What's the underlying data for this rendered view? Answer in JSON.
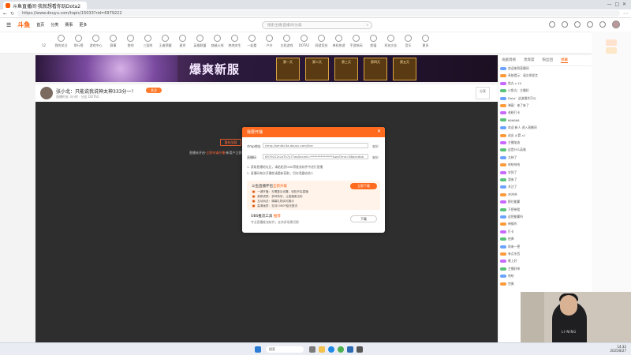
{
  "browser": {
    "tab_title": "斗鱼直播间·我就想看你玩Dota2",
    "url": "https://www.douyu.com/topic/15033?rid=6979222",
    "favicon": "douyu-fish-icon"
  },
  "site": {
    "logo": "斗鱼",
    "nav": [
      "首页",
      "分类",
      "赛事",
      "更多"
    ],
    "search_placeholder": "搜索主播/直播间/分类"
  },
  "categories": [
    "12",
    "我的关注",
    "排行榜",
    "游戏中心",
    "赛事",
    "鱼吧",
    "三国杀",
    "王者荣耀",
    "星秀",
    "英雄联盟",
    "穿越火线",
    "绝地求生",
    "一起看",
    "户外",
    "主机游戏",
    "DOTA2",
    "网游竞技",
    "单机热游",
    "手游休闲",
    "颜值",
    "科技文化",
    "音乐",
    "更多"
  ],
  "banner": {
    "title": "爆爽新服",
    "cards": [
      "第一天",
      "第二天",
      "第三天",
      "第四天",
      "第五天"
    ]
  },
  "room": {
    "title": "张小北：只能说我说神太神333分一！",
    "follow_label": "关注",
    "meta": "直播时长 3小时 · 分区 DOTA2",
    "share_label": "分享"
  },
  "video": {
    "button_label": "重新加载",
    "notice_prefix": "直播未开启·",
    "notice_link": "立即申请开播",
    "notice_suffix": "·新用户立即开播享受流量扶持"
  },
  "dialog": {
    "title": "我要开播",
    "server_label": "rtmp地址",
    "server_value": "rtmp://sendtc3a.douyu.com/live",
    "key_label": "直播码",
    "key_value": "6979222rLbTh7y7?wsSecret=***************&wsTime=68aecdbb",
    "copy_label": "复制",
    "note1": "1. 获取直播地址后，请粘贴到OBS等推流软件中进行直播",
    "note2": "2. 直播码每次开播前请重新获取，切勿泄露给他人",
    "promo_title_prefix": "斗鱼直播伴侣",
    "promo_title_highlight": "全新升级",
    "promo_button": "立即下载",
    "promo_lines": [
      "一键开播：无需复杂设置，轻松开启直播",
      "美颜滤镜：多种特效，让直播更出彩",
      "互动玩法：弹幕礼物实时展示",
      "高清画质：支持1080P蓝光推流"
    ],
    "download_title_prefix": "OBS推流工具",
    "download_title_highlight": "推荐",
    "download_desc": "专业直播推流软件，支持多场景切换",
    "download_button": "下载"
  },
  "right_panel": {
    "tabs": [
      "贡献周榜",
      "贵宾席",
      "粉丝团",
      "弹幕"
    ],
    "chat_lines": [
      "欢迎来到直播间",
      "系统提示：请文明发言",
      "鱼丸 x 10",
      "小鱼丸：主播好",
      "Dota：这波操作可以",
      "弹幕：来了来了",
      "老粉打卡",
      "666666",
      "欢迎 新人 进入直播间",
      "送出 火箭 x1",
      "主播加油",
      "这是什么英雄",
      "太神了",
      "哈哈哈哈",
      "学到了",
      "我来了",
      "关注了",
      "冲冲冲",
      "稳住能赢",
      "下把带我",
      "这把能赢吗",
      "神操作",
      "打卡",
      "经典",
      "再来一把",
      "有点东西",
      "晚上好",
      "主播好帅",
      "哈哈",
      "完美"
    ]
  },
  "webcam": {
    "shirt_text": "LI-NING"
  },
  "taskbar": {
    "search_label": "搜索",
    "time": "14:32",
    "date": "2025/8/27"
  },
  "colors": {
    "accent": "#ff5a00",
    "dialog_header": "#ff6a1e",
    "video_bg": "#2e2e2e"
  }
}
